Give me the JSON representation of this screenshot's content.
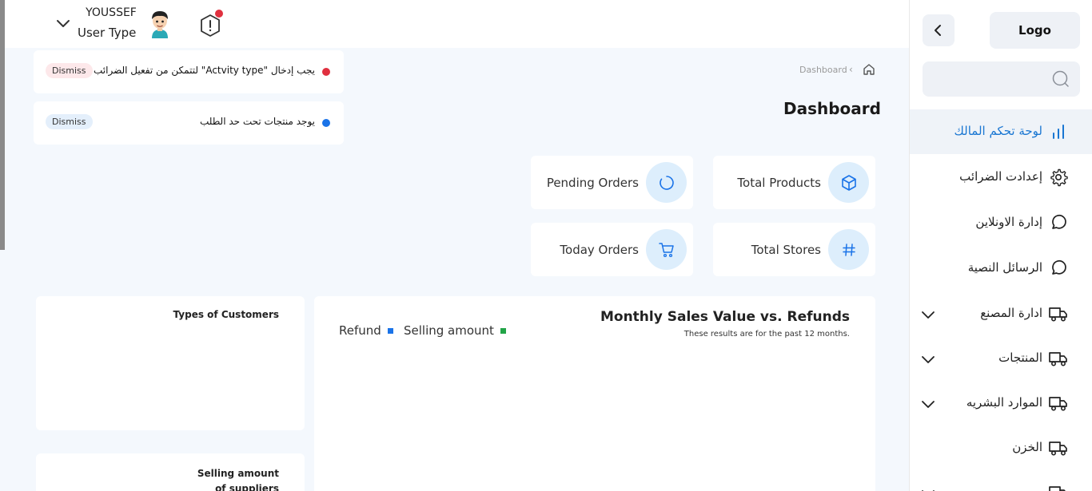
{
  "user": {
    "name": "YOUSSEF",
    "type": "User Type"
  },
  "notifications": [
    {
      "text": "يجب إدخال \"Actvity type\" لتتمكن من تفعيل الضرائب",
      "dismiss": "Dismiss",
      "color": "#e0303f",
      "badge_bg": "#fde8ea"
    },
    {
      "text": "يوجد منتجات تحت حد الطلب",
      "dismiss": "Dismiss",
      "color": "#1a73e8",
      "badge_bg": "#e4effb"
    }
  ],
  "breadcrumb": {
    "current": "Dashboard"
  },
  "page_title": "Dashboard",
  "stats": {
    "total_products": "Total Products",
    "pending_orders": "Pending Orders",
    "total_stores": "Total Stores",
    "today_orders": "Today Orders"
  },
  "sales_chart": {
    "title": "Monthly Sales Value vs. Refunds",
    "subtitle": "These results are for the past 12 months.",
    "legend": [
      {
        "label": "Selling amount",
        "color": "#22a447"
      },
      {
        "label": "Refund",
        "color": "#1a73e8"
      }
    ]
  },
  "customers_panel": {
    "title": "Types of Customers"
  },
  "suppliers_panel": {
    "title": "Selling amount of suppliers"
  },
  "sidebar": {
    "logo": "Logo",
    "search_placeholder": "",
    "items": [
      {
        "label": "لوحة تحكم المالك",
        "icon": "chart-bars-icon",
        "active": true
      },
      {
        "label": "إعدادت الضرائب",
        "icon": "gear-icon"
      },
      {
        "label": "إدارة الاونلاين",
        "icon": "chat-bubble-icon"
      },
      {
        "label": "الرسائل النصية",
        "icon": "chat-bubble-icon"
      },
      {
        "label": "ادارة المصنع",
        "icon": "truck-icon",
        "expandable": true
      },
      {
        "label": "المنتجات",
        "icon": "truck-icon",
        "expandable": true
      },
      {
        "label": "الموارد البشريه",
        "icon": "truck-icon",
        "expandable": true
      },
      {
        "label": "الخزن",
        "icon": "truck-icon"
      },
      {
        "label": "",
        "icon": "truck-icon",
        "expandable": true
      }
    ]
  },
  "colors": {
    "accent": "#1976d2",
    "icon_circle": "#ddeefc",
    "background": "#f4f8fd"
  }
}
